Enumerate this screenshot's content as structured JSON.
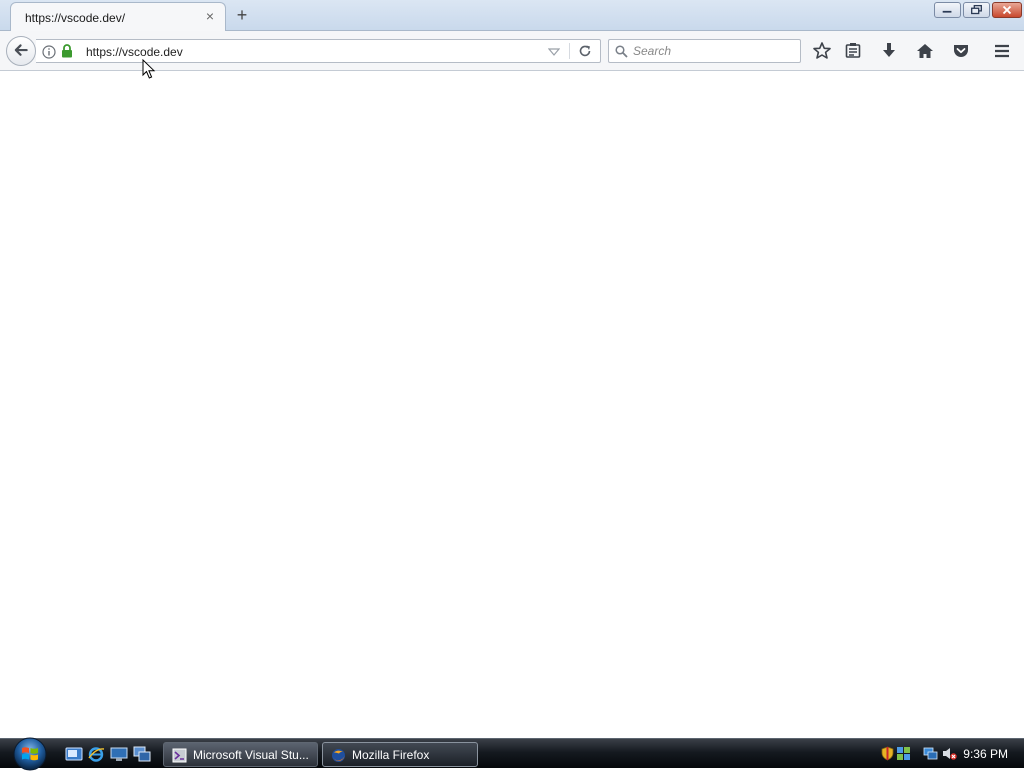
{
  "browser": {
    "tab": {
      "title": "https://vscode.dev/",
      "close_glyph": "×"
    },
    "new_tab_glyph": "+",
    "window_controls": [
      "minimize",
      "restore",
      "close"
    ]
  },
  "navbar": {
    "url": "https://vscode.dev",
    "search_placeholder": "Search",
    "toolbar_icons": [
      "bookmark-star-icon",
      "reading-list-icon",
      "downloads-icon",
      "home-icon",
      "pocket-icon",
      "menu-icon"
    ]
  },
  "taskbar": {
    "tasks": [
      {
        "label": "Microsoft Visual Stu...",
        "icon": "visual-studio-icon"
      },
      {
        "label": "Mozilla Firefox",
        "icon": "firefox-icon"
      }
    ],
    "quick_launch": [
      "show-desktop-icon",
      "internet-explorer-icon",
      "computer-icon",
      "switch-windows-icon"
    ],
    "tray_icons": [
      "security-shield-icon",
      "network-sharing-icon",
      "network-icon",
      "volume-muted-icon"
    ],
    "clock": "9:36 PM"
  },
  "colors": {
    "accent_lock": "#3c9a2f",
    "taskbar_dark": "#151a20",
    "close_button": "#c8482d"
  }
}
